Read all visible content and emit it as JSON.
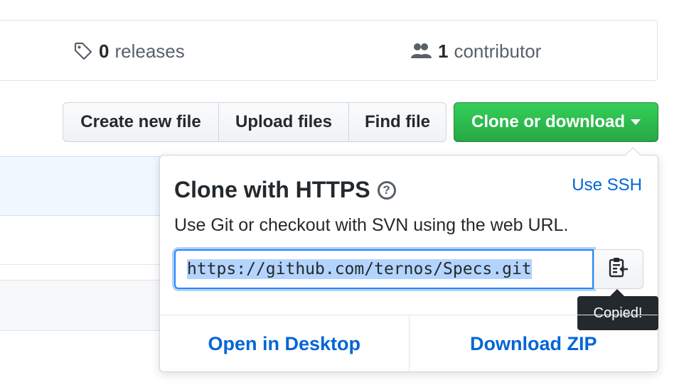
{
  "stats": {
    "releases_count": "0",
    "releases_label": "releases",
    "contributors_count": "1",
    "contributors_label": "contributor"
  },
  "actions": {
    "create_new_file": "Create new file",
    "upload_files": "Upload files",
    "find_file": "Find file",
    "clone_or_download": "Clone or download"
  },
  "clone_panel": {
    "title": "Clone with HTTPS",
    "help_glyph": "?",
    "use_ssh": "Use SSH",
    "description": "Use Git or checkout with SVN using the web URL.",
    "url": "https://github.com/ternos/Specs.git",
    "tooltip": "Copied!",
    "open_in_desktop": "Open in Desktop",
    "download_zip": "Download ZIP"
  },
  "colors": {
    "accent_green": "#28a745",
    "link_blue": "#0366d6",
    "tooltip_bg": "#24292e"
  }
}
